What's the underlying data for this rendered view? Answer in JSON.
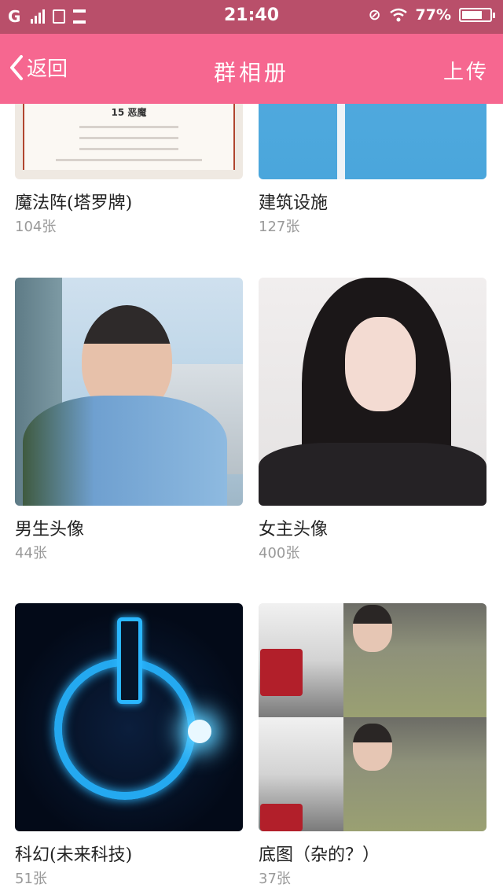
{
  "status_bar": {
    "carrier": "G",
    "time": "21:40",
    "battery": "77%",
    "battery_level": 0.77
  },
  "header": {
    "back_label": "返回",
    "title": "群相册",
    "upload_label": "上传"
  },
  "albums": [
    {
      "name": "魔法阵(塔罗牌)",
      "count": "104张"
    },
    {
      "name": "建筑设施",
      "count": "127张"
    },
    {
      "name": "男生头像",
      "count": "44张"
    },
    {
      "name": "女主头像",
      "count": "400张"
    },
    {
      "name": "科幻(未来科技)",
      "count": "51张"
    },
    {
      "name": "底图（杂的？）",
      "count": "37张"
    }
  ],
  "tarot_card": {
    "heading": "15 恶魔"
  },
  "colors": {
    "status_bar": "#b94f6a",
    "header": "#f66790",
    "count_text": "#9a9a9a"
  }
}
